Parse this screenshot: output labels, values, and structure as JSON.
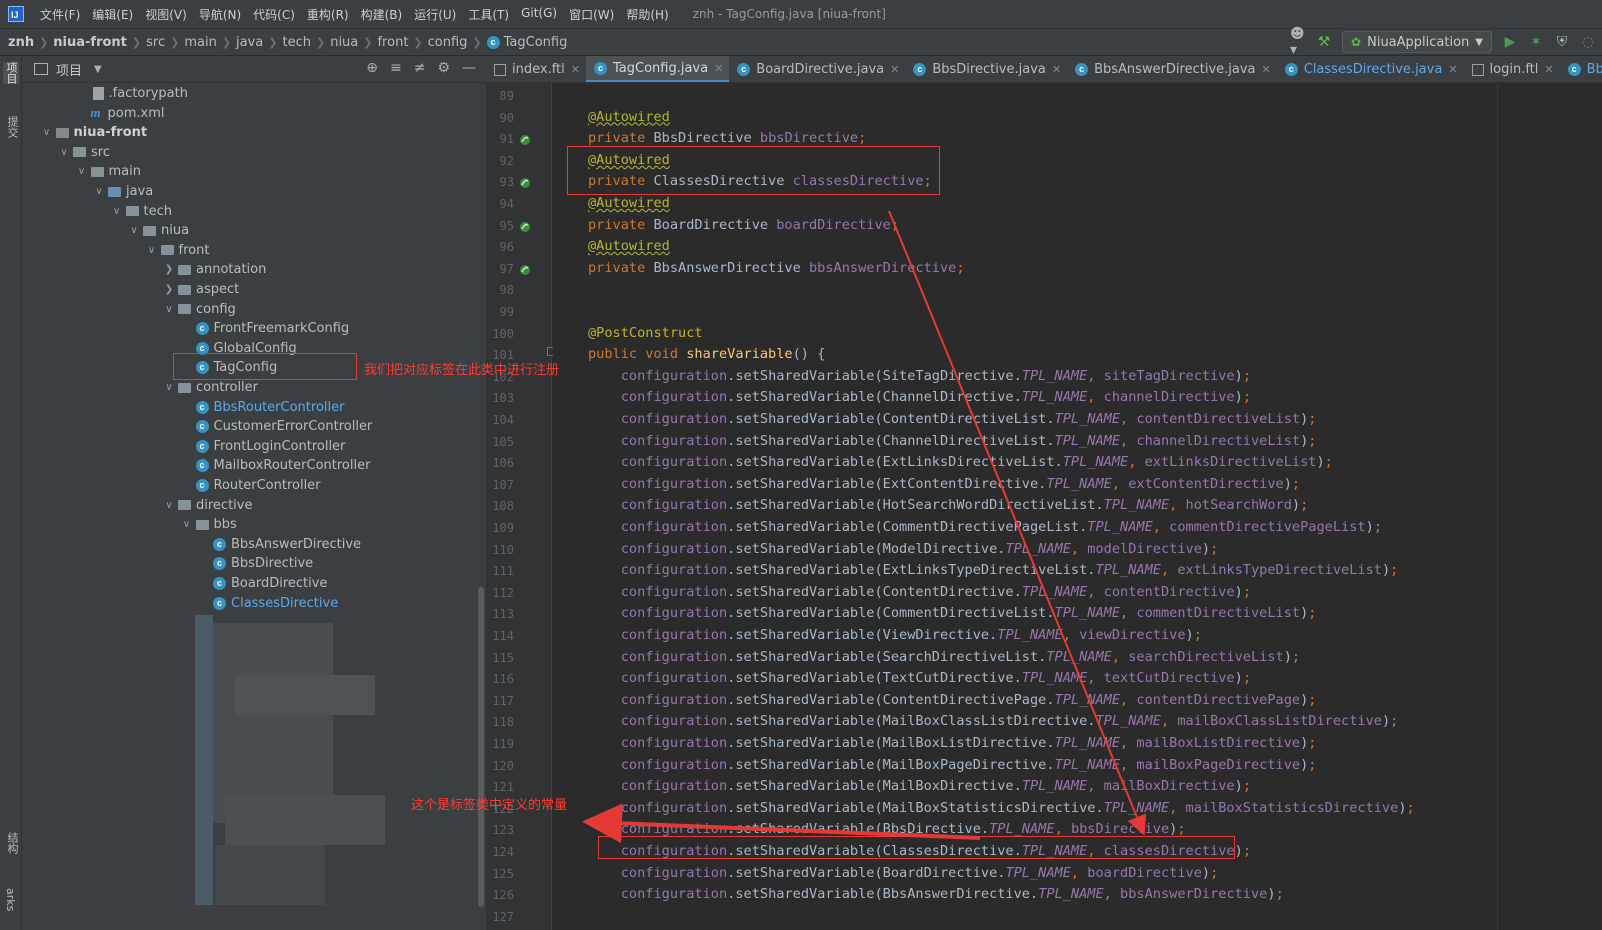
{
  "menubar": {
    "items": [
      "文件(F)",
      "编辑(E)",
      "视图(V)",
      "导航(N)",
      "代码(C)",
      "重构(R)",
      "构建(B)",
      "运行(U)",
      "工具(T)",
      "Git(G)",
      "窗口(W)",
      "帮助(H)"
    ],
    "window_title": "znh - TagConfig.java [niua-front]"
  },
  "navbar": {
    "crumbs": [
      "znh",
      "niua-front",
      "src",
      "main",
      "java",
      "tech",
      "niua",
      "front",
      "config",
      "TagConfig"
    ]
  },
  "toolbar": {
    "run_config": "NiuaApplication"
  },
  "left_strip": {
    "project": "项目",
    "commit": "提交",
    "structure": "结构",
    "bookmarks": "arks"
  },
  "project_panel": {
    "title": "项目",
    "tree": [
      {
        "label": ".factorypath",
        "icon": "file"
      },
      {
        "label": "pom.xml",
        "icon": "maven"
      },
      {
        "label": "niua-front",
        "icon": "module-folder",
        "bold": true
      },
      {
        "label": "src",
        "icon": "folder"
      },
      {
        "label": "main",
        "icon": "folder"
      },
      {
        "label": "java",
        "icon": "source-folder"
      },
      {
        "label": "tech",
        "icon": "package"
      },
      {
        "label": "niua",
        "icon": "package"
      },
      {
        "label": "front",
        "icon": "package"
      },
      {
        "label": "annotation",
        "icon": "package"
      },
      {
        "label": "aspect",
        "icon": "package"
      },
      {
        "label": "config",
        "icon": "package"
      },
      {
        "label": "FrontFreemarkConfig",
        "icon": "class"
      },
      {
        "label": "GlobalConfig",
        "icon": "class"
      },
      {
        "label": "TagConfig",
        "icon": "class"
      },
      {
        "label": "controller",
        "icon": "package"
      },
      {
        "label": "BbsRouterController",
        "icon": "class",
        "modified": true
      },
      {
        "label": "CustomerErrorController",
        "icon": "class"
      },
      {
        "label": "FrontLoginController",
        "icon": "class"
      },
      {
        "label": "MailboxRouterController",
        "icon": "class"
      },
      {
        "label": "RouterController",
        "icon": "class"
      },
      {
        "label": "directive",
        "icon": "package"
      },
      {
        "label": "bbs",
        "icon": "package"
      },
      {
        "label": "BbsAnswerDirective",
        "icon": "class"
      },
      {
        "label": "BbsDirective",
        "icon": "class"
      },
      {
        "label": "BoardDirective",
        "icon": "class"
      },
      {
        "label": "ClassesDirective",
        "icon": "class",
        "modified": true
      }
    ]
  },
  "editor_tabs": [
    {
      "label": "index.ftl",
      "type": "ftl"
    },
    {
      "label": "TagConfig.java",
      "type": "class",
      "active": true
    },
    {
      "label": "BoardDirective.java",
      "type": "class"
    },
    {
      "label": "BbsDirective.java",
      "type": "class"
    },
    {
      "label": "BbsAnswerDirective.java",
      "type": "class"
    },
    {
      "label": "ClassesDirective.java",
      "type": "class",
      "modified": true
    },
    {
      "label": "login.ftl",
      "type": "ftl"
    },
    {
      "label": "BbsRouterCont",
      "type": "class",
      "modified": true
    }
  ],
  "editor": {
    "line_numbers": [
      "89",
      "90",
      "91",
      "92",
      "93",
      "94",
      "95",
      "96",
      "97",
      "98",
      "99",
      "100",
      "101",
      "102",
      "103",
      "104",
      "105",
      "106",
      "107",
      "108",
      "109",
      "110",
      "111",
      "112",
      "113",
      "114",
      "115",
      "116",
      "117",
      "118",
      "119",
      "120",
      "121",
      "122",
      "123",
      "124",
      "125",
      "126",
      "127"
    ],
    "bean_marker_lines": [
      "91",
      "93",
      "95",
      "97"
    ],
    "fields": [
      {
        "annotation": "@Autowired",
        "modifier": "private",
        "type": "BbsDirective",
        "name": "bbsDirective"
      },
      {
        "annotation": "@Autowired",
        "modifier": "private",
        "type": "ClassesDirective",
        "name": "classesDirective"
      },
      {
        "annotation": "@Autowired",
        "modifier": "private",
        "type": "BoardDirective",
        "name": "boardDirective"
      },
      {
        "annotation": "@Autowired",
        "modifier": "private",
        "type": "BbsAnswerDirective",
        "name": "bbsAnswerDirective"
      }
    ],
    "method": {
      "annotation": "@PostConstruct",
      "keywords": "public void",
      "name": "shareVariable",
      "params": "() {"
    },
    "call": {
      "receiver": "configuration",
      "method": "setSharedVariable",
      "constant": "TPL_NAME"
    },
    "registrations": [
      {
        "cls": "SiteTagDirective",
        "var": "siteTagDirective"
      },
      {
        "cls": "ChannelDirective",
        "var": "channelDirective"
      },
      {
        "cls": "ContentDirectiveList",
        "var": "contentDirectiveList"
      },
      {
        "cls": "ChannelDirectiveList",
        "var": "channelDirectiveList"
      },
      {
        "cls": "ExtLinksDirectiveList",
        "var": "extLinksDirectiveList"
      },
      {
        "cls": "ExtContentDirective",
        "var": "extContentDirective"
      },
      {
        "cls": "HotSearchWordDirectiveList",
        "var": "hotSearchWord"
      },
      {
        "cls": "CommentDirectivePageList",
        "var": "commentDirectivePageList"
      },
      {
        "cls": "ModelDirective",
        "var": "modelDirective"
      },
      {
        "cls": "ExtLinksTypeDirectiveList",
        "var": "extLinksTypeDirectiveList"
      },
      {
        "cls": "ContentDirective",
        "var": "contentDirective"
      },
      {
        "cls": "CommentDirectiveList",
        "var": "commentDirectiveList"
      },
      {
        "cls": "ViewDirective",
        "var": "viewDirective"
      },
      {
        "cls": "SearchDirectiveList",
        "var": "searchDirectiveList"
      },
      {
        "cls": "TextCutDirective",
        "var": "textCutDirective"
      },
      {
        "cls": "ContentDirectivePage",
        "var": "contentDirectivePage"
      },
      {
        "cls": "MailBoxClassListDirective",
        "var": "mailBoxClassListDirective"
      },
      {
        "cls": "MailBoxListDirective",
        "var": "mailBoxListDirective"
      },
      {
        "cls": "MailBoxPageDirective",
        "var": "mailBoxPageDirective"
      },
      {
        "cls": "MailBoxDirective",
        "var": "mailBoxDirective"
      },
      {
        "cls": "MailBoxStatisticsDirective",
        "var": "mailBoxStatisticsDirective"
      },
      {
        "cls": "BbsDirective",
        "var": "bbsDirective"
      },
      {
        "cls": "ClassesDirective",
        "var": "classesDirective"
      },
      {
        "cls": "BoardDirective",
        "var": "boardDirective"
      },
      {
        "cls": "BbsAnswerDirective",
        "var": "bbsAnswerDirective"
      }
    ]
  },
  "annotations": {
    "note_register": "我们把对应标签在此类中进行注册",
    "note_constant": "这个是标签类中定义的常量",
    "color": "#e53935"
  }
}
